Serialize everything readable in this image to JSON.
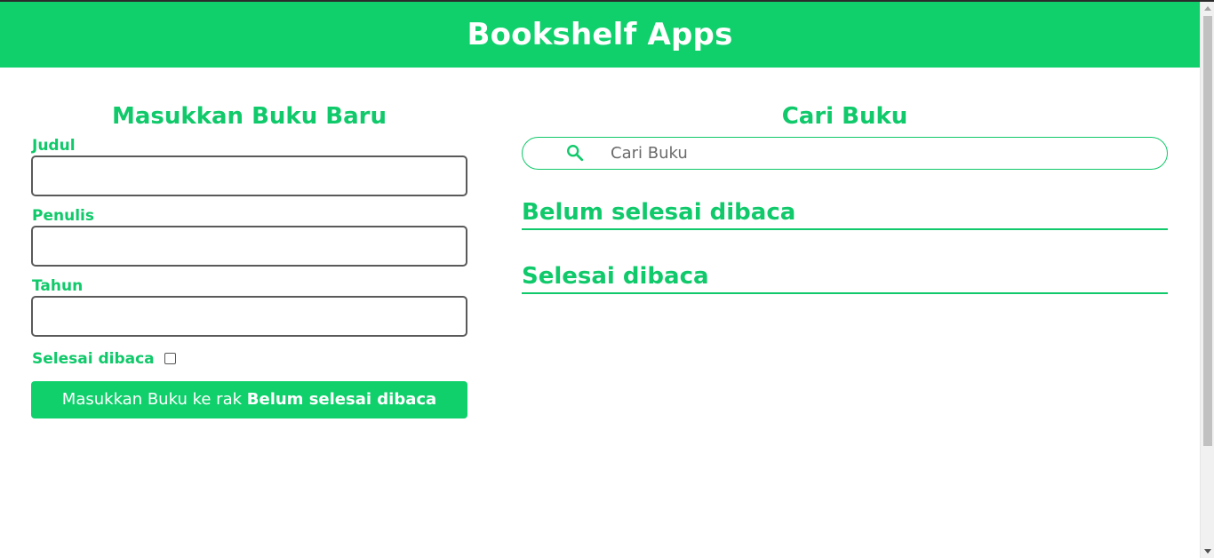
{
  "header": {
    "title": "Bookshelf Apps"
  },
  "colors": {
    "brand_green": "#10d06c",
    "text_green": "#10c96a"
  },
  "form": {
    "title": "Masukkan Buku Baru",
    "fields": [
      {
        "label": "Judul",
        "value": ""
      },
      {
        "label": "Penulis",
        "value": ""
      },
      {
        "label": "Tahun",
        "value": ""
      }
    ],
    "checkbox_label": "Selesai dibaca",
    "checkbox_checked": false,
    "submit_prefix": "Masukkan Buku ke rak",
    "submit_target": "Belum selesai dibaca"
  },
  "search": {
    "title": "Cari Buku",
    "placeholder": "Cari Buku",
    "icon": "search-icon"
  },
  "shelves": [
    {
      "title": "Belum selesai dibaca"
    },
    {
      "title": "Selesai dibaca"
    }
  ]
}
